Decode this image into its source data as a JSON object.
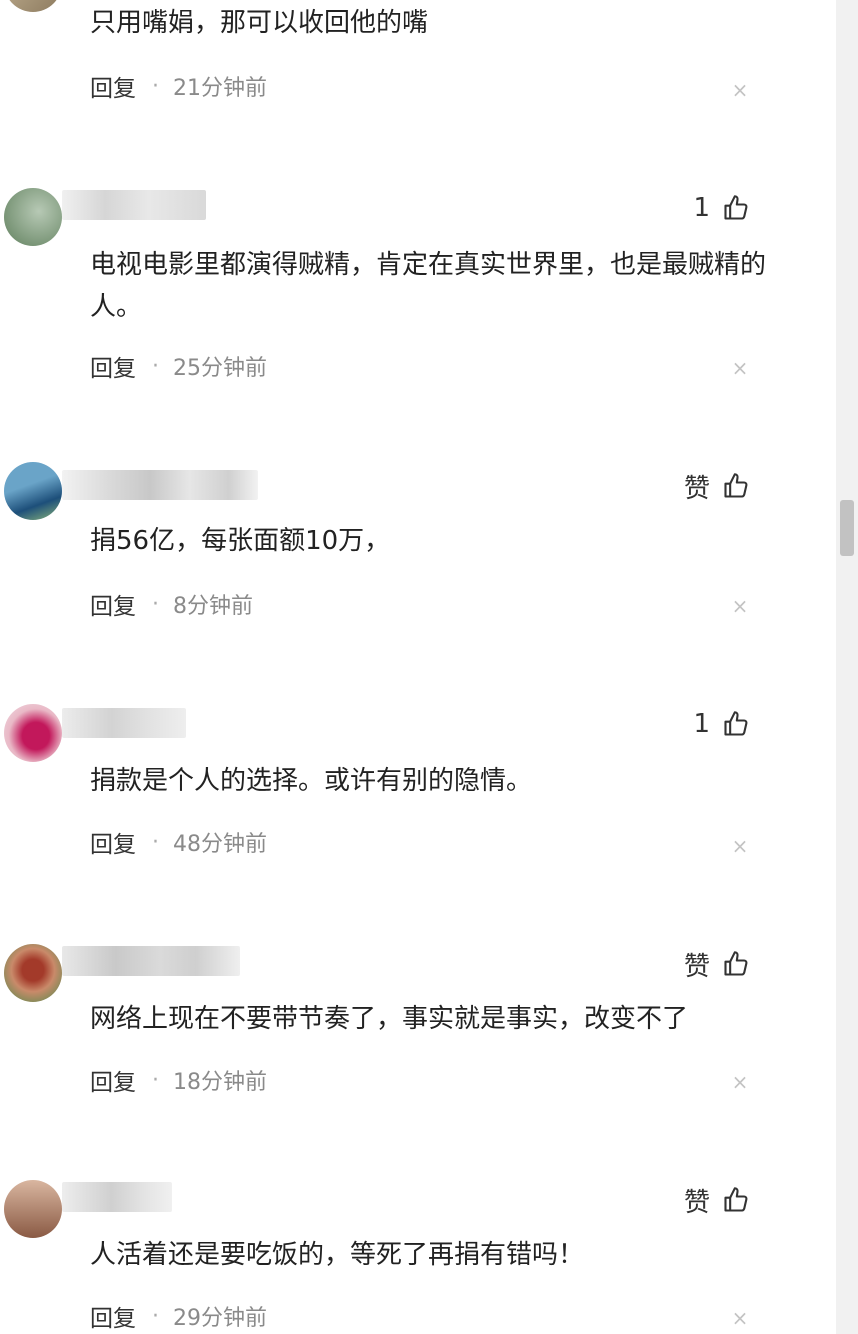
{
  "comments": [
    {
      "content": "只用嘴娟，那可以收回他的嘴",
      "reply_label": "回复",
      "separator": "·",
      "time": "21分钟前",
      "close_glyph": "×",
      "avatar_colors": [
        "#c9b89a",
        "#8c7a5e"
      ]
    },
    {
      "like_label": "1",
      "content": "电视电影里都演得贼精，肯定在真实世界里，也是最贼精的人。",
      "reply_label": "回复",
      "separator": "·",
      "time": "25分钟前",
      "close_glyph": "×",
      "avatar_colors": [
        "#b7c9b5",
        "#5f7f5c"
      ]
    },
    {
      "like_label": "赞",
      "content": "捐56亿，每张面额10万，",
      "reply_label": "回复",
      "separator": "·",
      "time": "8分钟前",
      "close_glyph": "×",
      "avatar_colors": [
        "#6aa4c8",
        "#1d4f7a"
      ]
    },
    {
      "like_label": "1",
      "content": "捐款是个人的选择。或许有别的隐情。",
      "reply_label": "回复",
      "separator": "·",
      "time": "48分钟前",
      "close_glyph": "×",
      "avatar_colors": [
        "#e9b8c6",
        "#c2185b"
      ]
    },
    {
      "like_label": "赞",
      "content": "网络上现在不要带节奏了，事实就是事实，改变不了",
      "reply_label": "回复",
      "separator": "·",
      "time": "18分钟前",
      "close_glyph": "×",
      "avatar_colors": [
        "#c98a6a",
        "#a33a2a"
      ]
    },
    {
      "like_label": "赞",
      "content": "人活着还是要吃饭的，等死了再捐有错吗！",
      "reply_label": "回复",
      "separator": "·",
      "time": "29分钟前",
      "close_glyph": "×",
      "avatar_colors": [
        "#d9b6a0",
        "#8a5a44"
      ]
    }
  ],
  "theme": {
    "text_color": "#222222",
    "meta_color": "#8a8a8a",
    "close_color": "#c3c3c3",
    "username_blur_color": "#d6d6d6"
  }
}
